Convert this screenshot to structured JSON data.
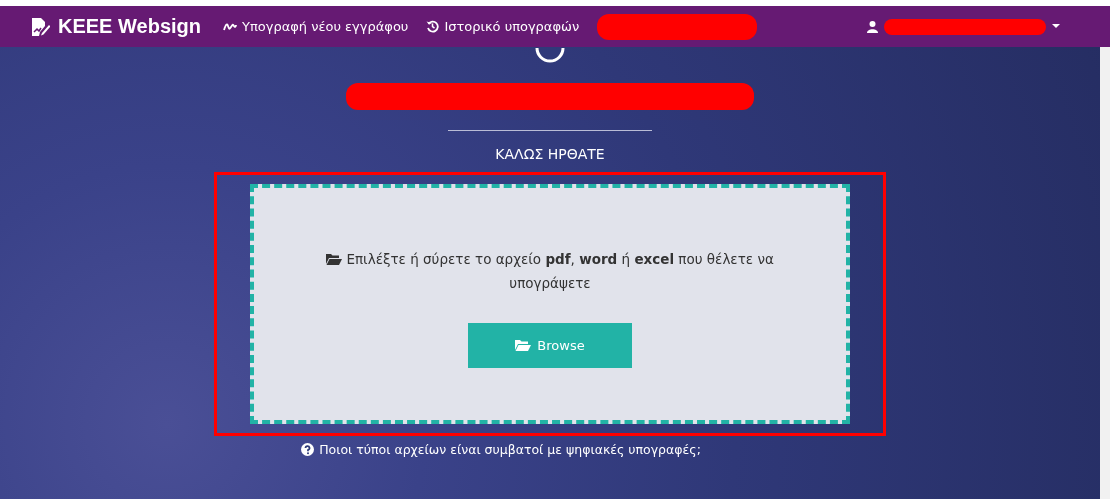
{
  "navbar": {
    "brand": "KEEE Websign",
    "links": [
      {
        "label": "Υπογραφή νέου εγγράφου",
        "kind": "sign"
      },
      {
        "label": "Ιστορικό υπογραφών",
        "kind": "history"
      }
    ]
  },
  "welcome": "ΚΑΛΩΣ ΗΡΘΑΤΕ",
  "dropzone": {
    "instruction": "Επιλέξτε ή σύρετε το αρχείο **pdf**, **word** ή **excel** που θέλετε να υπογράψετε",
    "button": "Browse"
  },
  "help_link": "Ποιοι τύποι αρχείων είναι συμβατοί με ψηφιακές υπογραφές;"
}
